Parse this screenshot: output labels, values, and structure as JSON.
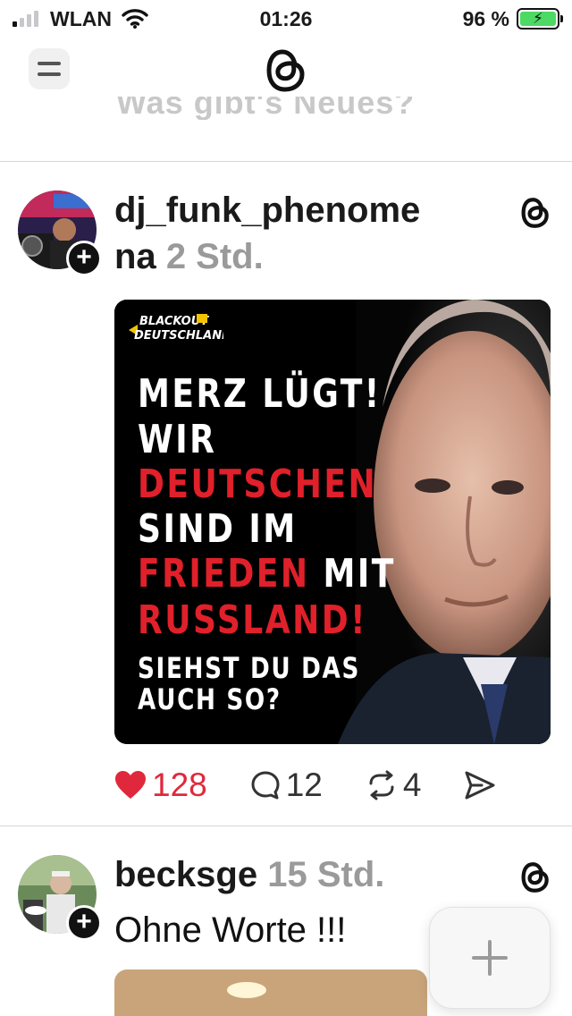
{
  "status_bar": {
    "carrier": "WLAN",
    "time": "01:26",
    "battery_percent": "96 %",
    "signal_bars_active": 1,
    "battery_color": "#4cd964"
  },
  "nav": {
    "menu_icon": "hamburger-menu-icon",
    "logo_icon": "threads-logo-icon"
  },
  "composer": {
    "ghost_text": "Was gibt's Neues?"
  },
  "posts": [
    {
      "username_line1": "dj_funk_phenome",
      "username_line2": "na",
      "time": "2 Std.",
      "image": {
        "brand_line1": "BLACKOUT",
        "brand_line2": "DEUTSCHLAND",
        "lines": [
          {
            "parts": [
              {
                "text": "MERZ LÜGT!",
                "color": "white"
              }
            ]
          },
          {
            "parts": [
              {
                "text": "WIR",
                "color": "white"
              }
            ]
          },
          {
            "parts": [
              {
                "text": "DEUTSCHEN",
                "color": "red"
              }
            ]
          },
          {
            "parts": [
              {
                "text": "SIND IM",
                "color": "white"
              }
            ]
          },
          {
            "parts": [
              {
                "text": "FRIEDEN",
                "color": "red"
              },
              {
                "text": " MIT",
                "color": "white"
              }
            ]
          },
          {
            "parts": [
              {
                "text": "RUSSLAND!",
                "color": "red"
              }
            ]
          },
          {
            "parts": [
              {
                "text": "SIEHST DU DAS",
                "color": "white"
              }
            ]
          },
          {
            "parts": [
              {
                "text": "AUCH SO?",
                "color": "white"
              }
            ]
          }
        ]
      },
      "likes": "128",
      "comments": "12",
      "reposts": "4",
      "liked": true
    },
    {
      "username": "becksge",
      "time": "15 Std.",
      "text": "Ohne Worte !!!"
    }
  ],
  "fab": {
    "icon": "plus-icon"
  },
  "colors": {
    "like_red": "#e0283c",
    "text_gray": "#9a9a9a",
    "headline_red": "#e0202a"
  }
}
